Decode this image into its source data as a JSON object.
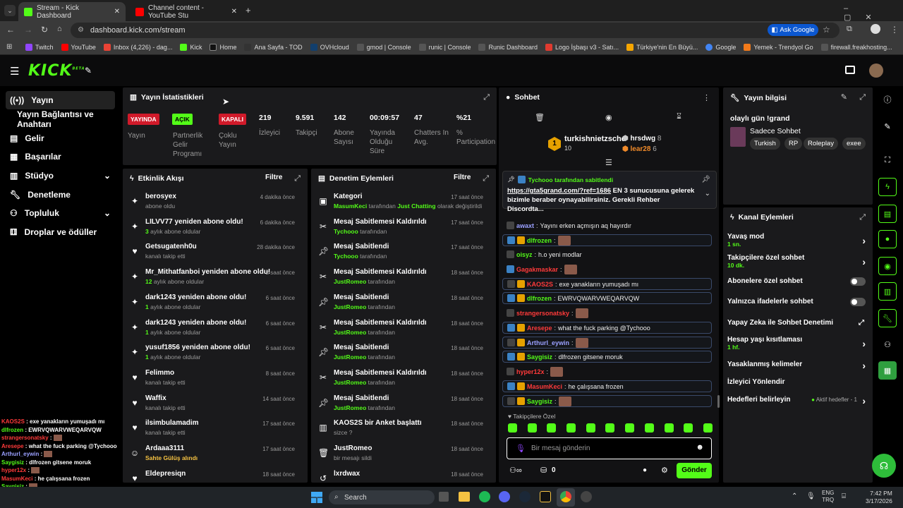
{
  "browser": {
    "tabs": [
      {
        "label": "Stream - Kick Dashboard",
        "active": true
      },
      {
        "label": "Channel content - YouTube Stu",
        "active": false
      }
    ],
    "url": "dashboard.kick.com/stream",
    "ask_google": "Ask Google",
    "bookmarks": [
      "Twitch",
      "YouTube",
      "Inbox (4,226) - dag...",
      "Kick",
      "Home",
      "Ana Sayfa - TOD",
      "OVHcloud",
      "gmod | Console",
      "runic | Console",
      "Runic Dashboard",
      "Logo İşbaşı v3 - Satı...",
      "Türkiye'nin En Büyü...",
      "Google",
      "Yemek - Trendyol Go",
      "firewall.freakhosting..."
    ]
  },
  "header": {
    "logo": "KICK",
    "beta": "BETA"
  },
  "sidebar": {
    "items": [
      {
        "label": "Yayın",
        "selected": true
      },
      {
        "label": "Yayın Bağlantısı ve Anahtarı"
      },
      {
        "label": "Gelir"
      },
      {
        "label": "Başarılar"
      },
      {
        "label": "Stüdyo"
      },
      {
        "label": "Denetleme"
      },
      {
        "label": "Topluluk"
      },
      {
        "label": "Droplar ve ödüller"
      }
    ]
  },
  "stats": {
    "title": "Yayın İstatistikleri",
    "badges": [
      {
        "text": "YAYINDA",
        "label": "Yayın",
        "color": "#d11a2a"
      },
      {
        "text": "AÇIK",
        "label": "Partnerlik Gelir Programı",
        "color": "#53fc18"
      },
      {
        "text": "KAPALI",
        "label": "Çoklu Yayın",
        "color": "#d11a2a"
      }
    ],
    "values": [
      {
        "value": "219",
        "label": "İzleyici"
      },
      {
        "value": "9.591",
        "label": "Takipçi"
      },
      {
        "value": "142",
        "label": "Abone Sayısı"
      },
      {
        "value": "00:09:57",
        "label": "Yayında Olduğu Süre"
      },
      {
        "value": "47",
        "label": "Chatters In Avg."
      },
      {
        "value": "%21",
        "label": "% Participation"
      }
    ]
  },
  "activity": {
    "title": "Etkinlik Akışı",
    "filter": "Filtre",
    "rows": [
      {
        "title": "berosyex",
        "sub": "abone oldu",
        "time": "4 dakika önce"
      },
      {
        "title": "LILVV77 yeniden abone oldu!",
        "sub_num": "3",
        "sub": "aylık abone oldular",
        "time": "6 dakika önce"
      },
      {
        "title": "Getsugatenh0u",
        "sub": "kanalı takip etti",
        "time": "28 dakika önce"
      },
      {
        "title": "Mr_Mithatfanboi yeniden abone oldu!",
        "sub_num": "12",
        "sub": "aylık abone oldular",
        "time": "2 saat önce"
      },
      {
        "title": "dark1243 yeniden abone oldu!",
        "sub_num": "1",
        "sub": "aylık abone oldular",
        "time": "6 saat önce"
      },
      {
        "title": "dark1243 yeniden abone oldu!",
        "sub_num": "1",
        "sub": "aylık abone oldular",
        "time": "6 saat önce"
      },
      {
        "title": "yusuf1856 yeniden abone oldu!",
        "sub_num": "1",
        "sub": "aylık abone oldular",
        "time": "6 saat önce"
      },
      {
        "title": "Felimmo",
        "sub": "kanalı takip etti",
        "time": "8 saat önce"
      },
      {
        "title": "Waffix",
        "sub": "kanalı takip etti",
        "time": "14 saat önce"
      },
      {
        "title": "ilsimbulamadim",
        "sub": "kanalı takip etti",
        "time": "17 saat önce"
      },
      {
        "title": "Ardaaa3111",
        "sub": "Sahte Gülüş alındı",
        "time": "17 saat önce"
      },
      {
        "title": "Eldepresiqn",
        "sub": "",
        "time": "18 saat önce"
      }
    ]
  },
  "moderation": {
    "title": "Denetim Eylemleri",
    "filter": "Filtre",
    "rows": [
      {
        "title": "Kategori",
        "sub": "MasumKeci tarafından Just Chatting olarak değiştirildi",
        "time": "17 saat önce"
      },
      {
        "title": "Mesaj Sabitlemesi Kaldırıldı",
        "sub": "Tychooo tarafından",
        "time": "17 saat önce"
      },
      {
        "title": "Mesaj Sabitlendi",
        "sub": "Tychooo tarafından",
        "time": "17 saat önce"
      },
      {
        "title": "Mesaj Sabitlemesi Kaldırıldı",
        "sub": "JustRomeo tarafından",
        "time": "18 saat önce"
      },
      {
        "title": "Mesaj Sabitlendi",
        "sub": "JustRomeo tarafından",
        "time": "18 saat önce"
      },
      {
        "title": "Mesaj Sabitlemesi Kaldırıldı",
        "sub": "JustRomeo tarafından",
        "time": "18 saat önce"
      },
      {
        "title": "Mesaj Sabitlendi",
        "sub": "JustRomeo tarafından",
        "time": "18 saat önce"
      },
      {
        "title": "Mesaj Sabitlemesi Kaldırıldı",
        "sub": "JustRomeo tarafından",
        "time": "18 saat önce"
      },
      {
        "title": "Mesaj Sabitlendi",
        "sub": "JustRomeo tarafından",
        "time": "18 saat önce"
      },
      {
        "title": "KAOS2S bir Anket başlattı",
        "sub": "sizce ?",
        "time": "18 saat önce"
      },
      {
        "title": "JustRomeo",
        "sub": "bir mesajı sildi",
        "time": "18 saat önce"
      },
      {
        "title": "lxrdwax",
        "sub": "",
        "time": "18 saat önce"
      }
    ]
  },
  "chat": {
    "title": "Sohbet",
    "leaderboard": [
      {
        "rank": "1",
        "name": "turkishnietzsche",
        "count": "10"
      },
      {
        "name": "hrsdwg",
        "count": "8"
      },
      {
        "name": "lear28",
        "count": "6"
      }
    ],
    "pinned_by": "Tychooo tarafından sabitlendi",
    "pinned_link": "https://gta5grand.com/?ref=1686",
    "pinned_text": " EN 3 sunucusuna gelerek bizimle beraber oynayabilirsiniz. Gerekli Rehber Discordta...",
    "messages": [
      {
        "user": "awaxt",
        "text": "Yayını erken açmışın aq hayırdır",
        "color": "#9aa0ff"
      },
      {
        "user": "dlfrozen",
        "text": "",
        "color": "#53fc18"
      },
      {
        "user": "oisyz",
        "text": "h.o yeni modlar",
        "color": "#53fc18"
      },
      {
        "user": "Gagakmaskar",
        "text": "",
        "color": "#ff3a3a"
      },
      {
        "user": "KAOS2S",
        "text": "exe yanakların yumuşadı mı",
        "color": "#ff3a3a"
      },
      {
        "user": "dlfrozen",
        "text": "EWRVQWARVWEQARVQW",
        "color": "#53fc18"
      },
      {
        "user": "strangersonatsky",
        "text": "",
        "color": "#ff3a3a"
      },
      {
        "user": "Aresepe",
        "text": "what the fuck parking @Tychooo",
        "color": "#ff3a3a"
      },
      {
        "user": "Arthurl_eywin",
        "text": "",
        "color": "#9aa0ff"
      },
      {
        "user": "Saygisiz",
        "text": "dlfrozen gitsene moruk",
        "color": "#53fc18"
      },
      {
        "user": "hyper12x",
        "text": "",
        "color": "#ff3a3a"
      },
      {
        "user": "MasumKeci",
        "text": "he çalışsana frozen",
        "color": "#ff3a3a"
      },
      {
        "user": "Saygisiz",
        "text": "",
        "color": "#53fc18"
      }
    ],
    "followers_only": "Takipçilere Özel",
    "placeholder": "Bir mesaj gönderin",
    "points": "0",
    "send": "Gönder"
  },
  "stream_info": {
    "title": "Yayın bilgisi",
    "stream_title": "olaylı gün !grand",
    "category": "Sadece Sohbet",
    "tags": [
      "Turkish",
      "RP",
      "Roleplay",
      "exee"
    ]
  },
  "channel_actions": {
    "title": "Kanal Eylemleri",
    "rows": [
      {
        "label": "Yavaş mod",
        "sub": "1 sn.",
        "control": "chevron"
      },
      {
        "label": "Takipçilere özel sohbet",
        "sub": "10 dk.",
        "control": "chevron"
      },
      {
        "label": "Abonelere özel sohbet",
        "sub": "",
        "control": "toggle"
      },
      {
        "label": "Yalnızca ifadelerle sohbet",
        "sub": "",
        "control": "toggle"
      },
      {
        "label": "Yapay Zeka ile Sohbet Denetimi",
        "sub": "",
        "control": "external"
      },
      {
        "label": "Hesap yaşı kısıtlaması",
        "sub": "1 hf.",
        "control": "chevron"
      },
      {
        "label": "Yasaklanmış kelimeler",
        "sub": "",
        "control": "chevron"
      },
      {
        "label": "İzleyici Yönlendir",
        "sub": "",
        "control": "none"
      },
      {
        "label": "Hedefleri belirleyin",
        "sub": "",
        "control": "chevron",
        "status": "Aktif hedefler - 1"
      }
    ]
  },
  "overlay_chat": [
    {
      "user": "KAOS2S",
      "text": "exe yanakların yumuşadı mı"
    },
    {
      "user": "dlfrozen",
      "text": "EWRVQWARVWEQARVQW"
    },
    {
      "user": "strangersonatsky",
      "text": ""
    },
    {
      "user": "Aresepe",
      "text": "what the fuck parking @Tychooo"
    },
    {
      "user": "Arthurl_eywin",
      "text": ""
    },
    {
      "user": "Saygisiz",
      "text": "dlfrozen gitsene moruk"
    },
    {
      "user": "hyper12x",
      "text": ""
    },
    {
      "user": "MasumKeci",
      "text": "he çalışsana frozen"
    },
    {
      "user": "Saygisiz",
      "text": ""
    }
  ],
  "taskbar": {
    "search": "Search",
    "lang": "ENG",
    "lang2": "TRQ",
    "time": "7:42 PM",
    "date": "3/17/2026"
  },
  "colors": {
    "kick_green": "#53fc18",
    "live_red": "#d11a2a",
    "panel_bg": "#1a1a1c"
  }
}
